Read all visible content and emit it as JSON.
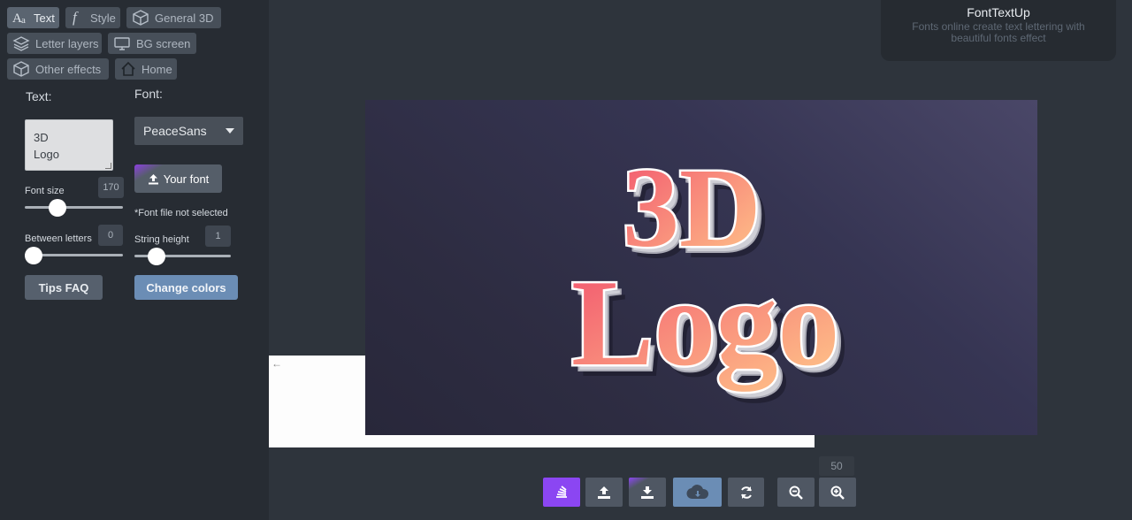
{
  "tabs": {
    "text": "Text",
    "style": "Style",
    "general3d": "General 3D",
    "letter_layers": "Letter layers",
    "bg_screen": "BG screen",
    "other_effects": "Other effects",
    "home": "Home"
  },
  "text_section": {
    "label": "Text:",
    "value": "3D\nLogo"
  },
  "font_section": {
    "label": "Font:",
    "selected": "PeaceSans",
    "your_font_label": "Your font",
    "note": "*Font file not selected"
  },
  "font_size": {
    "label": "Font size",
    "value": "170",
    "level": 0.3
  },
  "between_letters": {
    "label": "Between letters",
    "value": "0",
    "level": 0
  },
  "string_height": {
    "label": "String height",
    "value": "1",
    "level": 0.1
  },
  "buttons": {
    "tips_faq": "Tips FAQ",
    "change_colors": "Change colors"
  },
  "info_card": {
    "title": "FontTextUp",
    "subtitle": "Fonts online create text lettering with beautiful fonts effect"
  },
  "canvas": {
    "line1": "3D",
    "line2": "Logo",
    "gradient_colors": [
      "#f2546e",
      "#ffc98a"
    ]
  },
  "toolbar": {
    "zoom": "50",
    "icons": [
      "stack-icon",
      "upload-icon",
      "download-icon",
      "cloud-download-icon",
      "refresh-icon",
      "zoom-out-icon",
      "zoom-in-icon"
    ]
  },
  "colors": {
    "accent_purple": "#8b46f2",
    "accent_blue": "#6b8db5",
    "sidebar": "#272c33"
  }
}
